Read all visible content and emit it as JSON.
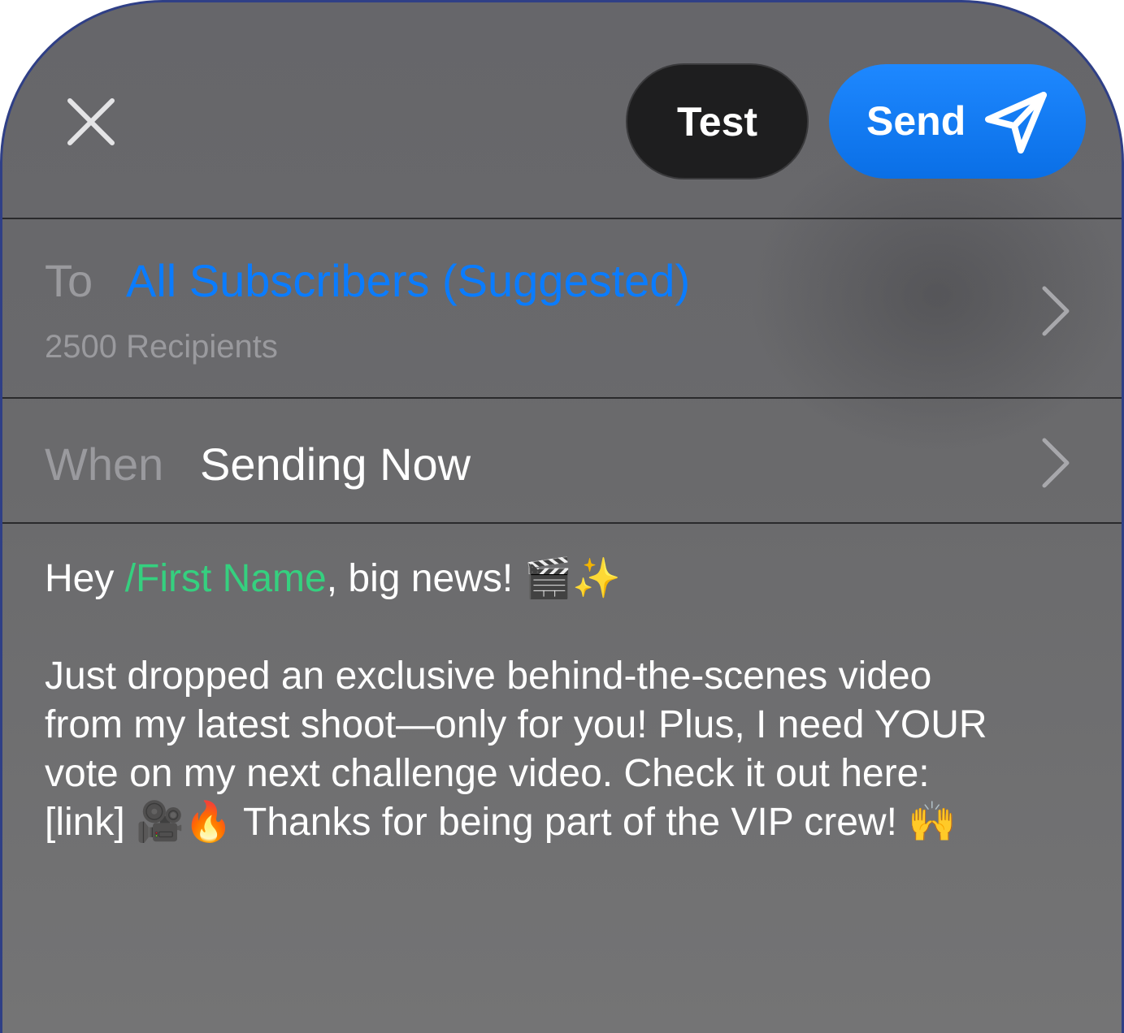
{
  "header": {
    "close_icon": "close-icon",
    "test_label": "Test",
    "send_label": "Send",
    "send_icon": "paper-plane-icon",
    "accent_color": "#0a7cff"
  },
  "to_row": {
    "label": "To",
    "value": "All Subscribers (Suggested)",
    "recipients": "2500 Recipients",
    "chevron_icon": "chevron-right-icon"
  },
  "when_row": {
    "label": "When",
    "value": "Sending Now",
    "chevron_icon": "chevron-right-icon"
  },
  "message": {
    "greeting_prefix": "Hey ",
    "merge_tag": "/First Name",
    "greeting_suffix": ", big news! 🎬✨",
    "line_1": "Just dropped an exclusive behind-the-scenes video",
    "line_2": "from my latest shoot—only for you! Plus, I need YOUR",
    "line_3": "vote on my next challenge video. Check it out here:",
    "line_4": "[link] 🎥🔥 Thanks for being part of the VIP crew! 🙌",
    "merge_tag_color": "#35d07f"
  }
}
